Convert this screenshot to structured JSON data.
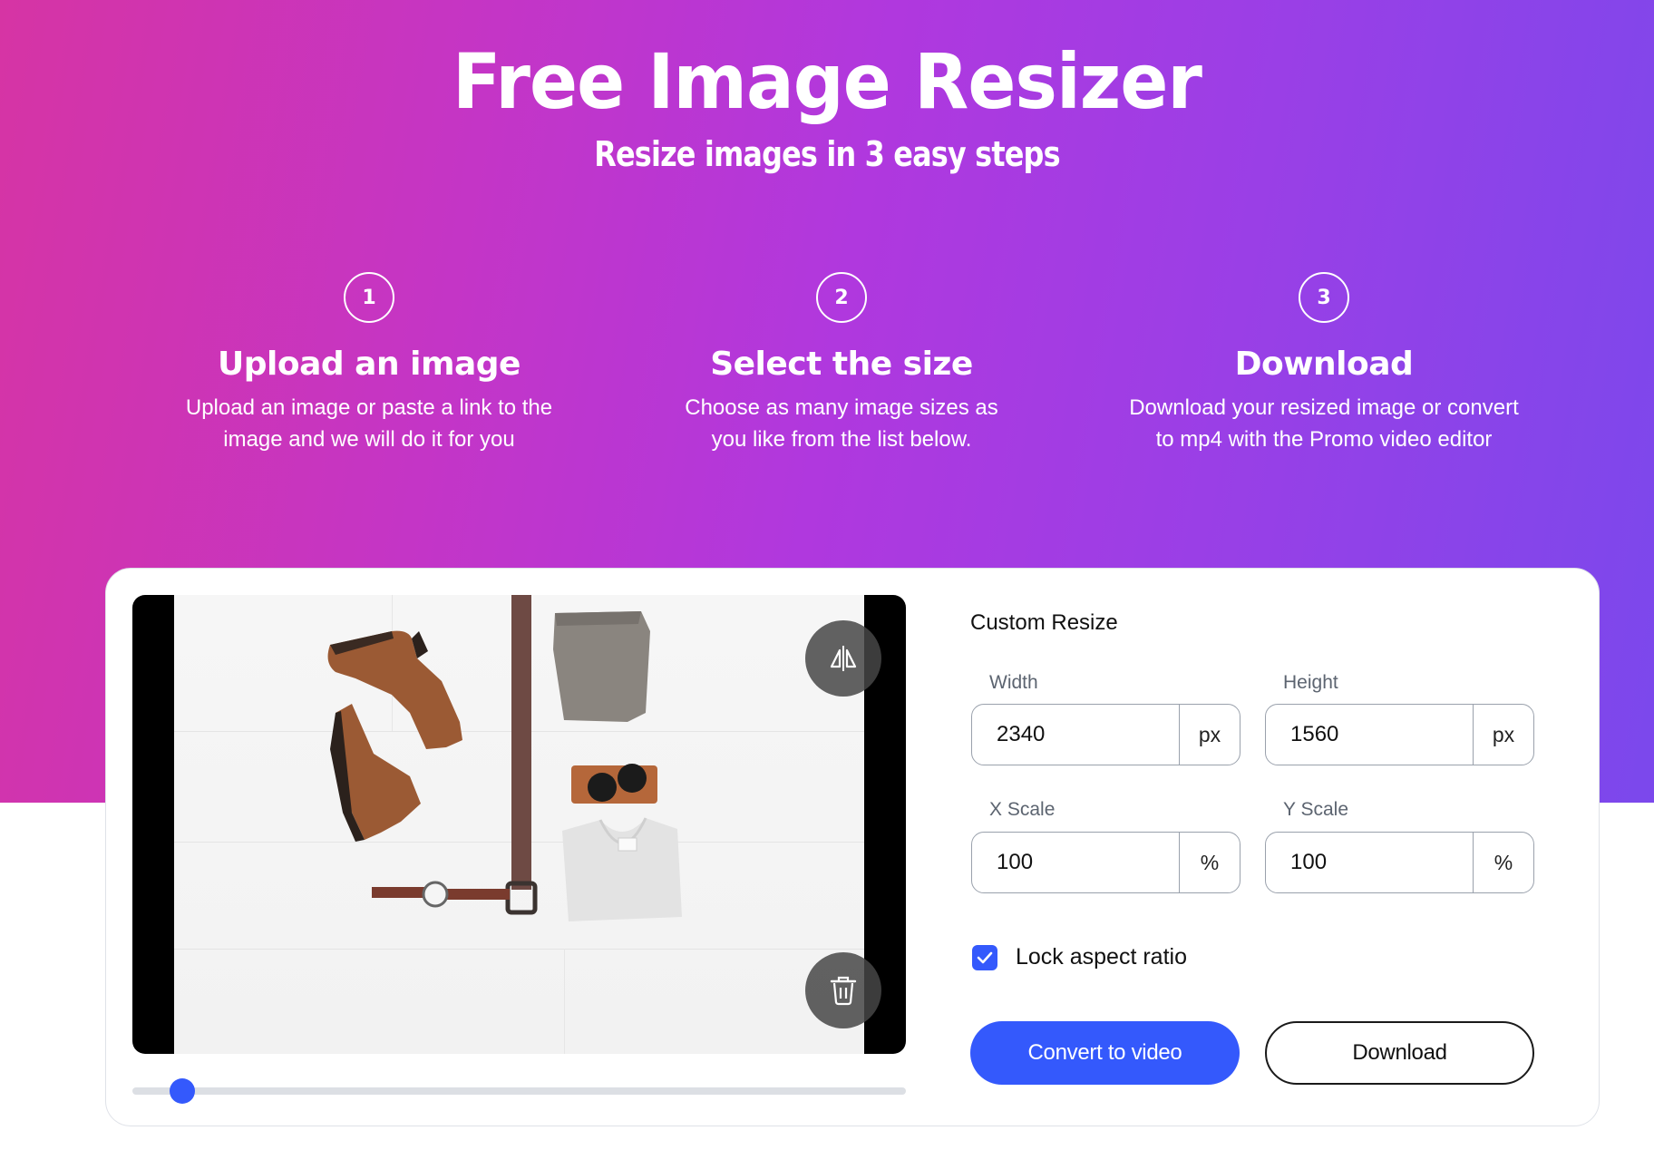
{
  "header": {
    "title": "Free Image Resizer",
    "subtitle": "Resize images in 3 easy steps"
  },
  "steps": [
    {
      "number": "1",
      "title": "Upload an image",
      "desc_line1": "Upload an image or paste a link to the",
      "desc_line2": "image and we will do it for you"
    },
    {
      "number": "2",
      "title": "Select the size",
      "desc_line1": "Choose as many image sizes as",
      "desc_line2": "you like from the list below."
    },
    {
      "number": "3",
      "title": "Download",
      "desc_line1": "Download your resized image or convert",
      "desc_line2": "to mp4 with the Promo video editor"
    }
  ],
  "preview": {
    "flip_icon": "flip-horizontal-icon",
    "delete_icon": "trash-icon",
    "zoom_slider_fraction": 0.05
  },
  "custom_resize": {
    "title": "Custom Resize",
    "width": {
      "label": "Width",
      "value": "2340",
      "unit": "px"
    },
    "height": {
      "label": "Height",
      "value": "1560",
      "unit": "px"
    },
    "x_scale": {
      "label": "X Scale",
      "value": "100",
      "unit": "%"
    },
    "y_scale": {
      "label": "Y Scale",
      "value": "100",
      "unit": "%"
    },
    "lock_aspect_ratio": {
      "label": "Lock aspect ratio",
      "checked": true
    }
  },
  "actions": {
    "convert_label": "Convert to video",
    "download_label": "Download"
  },
  "colors": {
    "gradient_start": "#d634a4",
    "gradient_end": "#7b48ec",
    "accent": "#3459fc"
  }
}
